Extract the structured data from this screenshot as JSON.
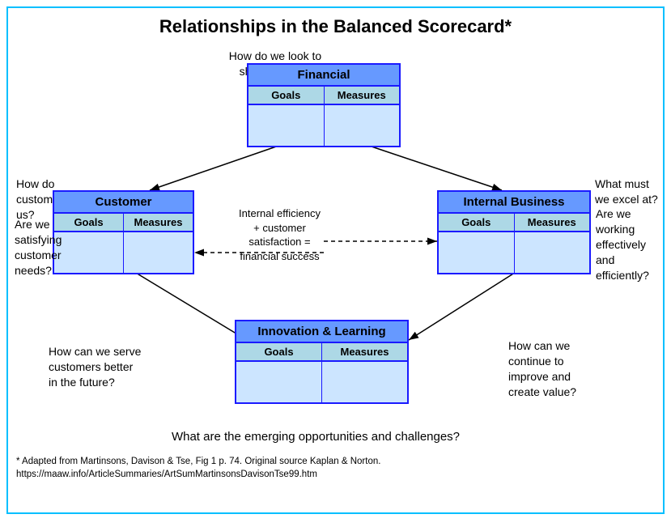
{
  "title": "Relationships in the Balanced Scorecard*",
  "shareholders_question": "How do we look to shareholders?",
  "customers_question": "How do customers\nsee us?",
  "excel_question": "What must\nwe excel at?",
  "satisfying_question": "Are we\nsatisfying\ncustomer\nneeds?",
  "working_question": "Are we\nworking\neffectively\nand\nefficiently?",
  "serve_question": "How can we\nserve customers\nbetter in the\nfuture?",
  "continue_question": "How can we\ncontinue to\nimprove and\ncreate value?",
  "emerging_question": "What are the emerging opportunities and challenges?",
  "center_text_line1": "Internal efficiency",
  "center_text_line2": "+ customer",
  "center_text_line3": "satisfaction =",
  "center_text_line4": "financial success",
  "boxes": {
    "financial": {
      "title": "Financial",
      "col1": "Goals",
      "col2": "Measures"
    },
    "customer": {
      "title": "Customer",
      "col1": "Goals",
      "col2": "Measures"
    },
    "internal": {
      "title": "Internal Business",
      "col1": "Goals",
      "col2": "Measures"
    },
    "innovation": {
      "title": "Innovation & Learning",
      "col1": "Goals",
      "col2": "Measures"
    }
  },
  "footnote_line1": "* Adapted from Martinsons, Davison & Tse, Fig 1  p. 74.  Original source Kaplan & Norton.",
  "footnote_line2": "https://maaw.info/ArticleSummaries/ArtSumMartinsonsDavisonTse99.htm"
}
